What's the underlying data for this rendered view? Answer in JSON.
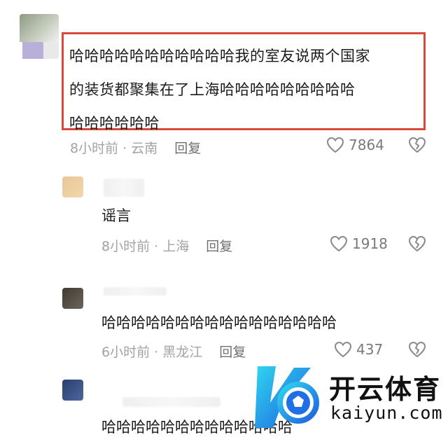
{
  "comments": [
    {
      "text_line1": "哈哈哈哈哈哈哈哈哈哈哈我的室友说两个国家",
      "text_line2": "的装货都聚集在了上海哈哈哈哈哈哈哈哈哈",
      "text_line3": "哈哈哈哈哈哈",
      "time": "8小时前",
      "location": "云南",
      "reply_label": "回复",
      "likes": "7864"
    },
    {
      "text": "谣言",
      "time": "8小时前",
      "location": "上海",
      "reply_label": "回复",
      "likes": "1918"
    },
    {
      "text": "哈哈哈哈哈哈哈哈哈哈哈哈哈哈哈哈",
      "time": "6小时前",
      "location": "黑龙江",
      "reply_label": "回复",
      "likes": "437"
    },
    {
      "text": "哈哈哈哈哈哈哈哈哈哈哈哈哈"
    }
  ],
  "separator": "·",
  "watermark": {
    "title": "开云体育",
    "url": "kaiyun.com"
  },
  "colors": {
    "highlight_border": "#d8493c",
    "meta_text": "#a3a3a3",
    "watermark_blue": "#1f7fe6",
    "watermark_cyan": "#2fd6ef"
  },
  "icons": [
    "heart-icon",
    "broken-heart-icon"
  ]
}
